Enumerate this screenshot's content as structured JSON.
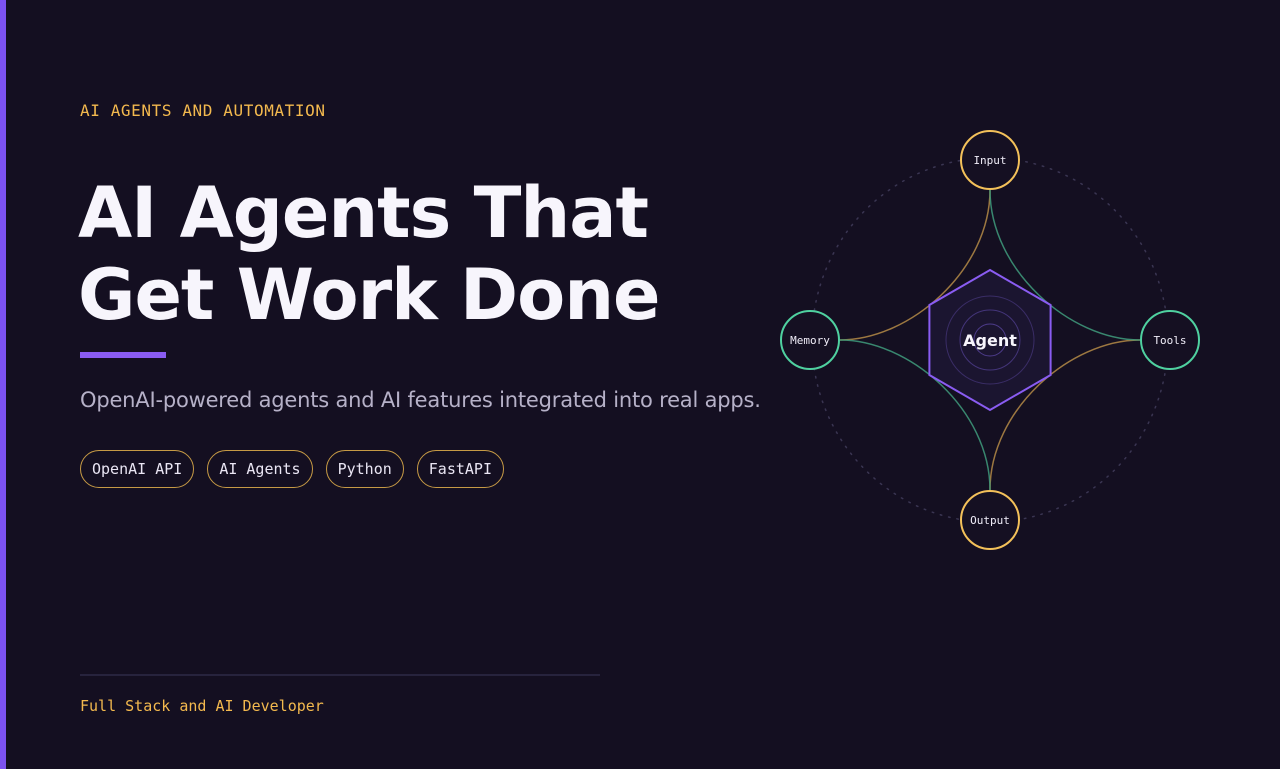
{
  "hero": {
    "eyebrow": "AI AGENTS AND AUTOMATION",
    "headline_line1": "AI Agents That",
    "headline_line2": "Get Work Done",
    "subtitle": "OpenAI-powered agents and AI features integrated into real apps.",
    "tags": [
      "OpenAI API",
      "AI Agents",
      "Python",
      "FastAPI"
    ]
  },
  "diagram": {
    "center": "Agent",
    "nodes": {
      "top": "Input",
      "left": "Memory",
      "right": "Tools",
      "bottom": "Output"
    }
  },
  "footer": {
    "role": "Full Stack and AI Developer"
  },
  "colors": {
    "background": "#140f21",
    "accent_purple": "#7c52f0",
    "accent_gold": "#f3b94e",
    "accent_teal": "#4fd1a0"
  }
}
